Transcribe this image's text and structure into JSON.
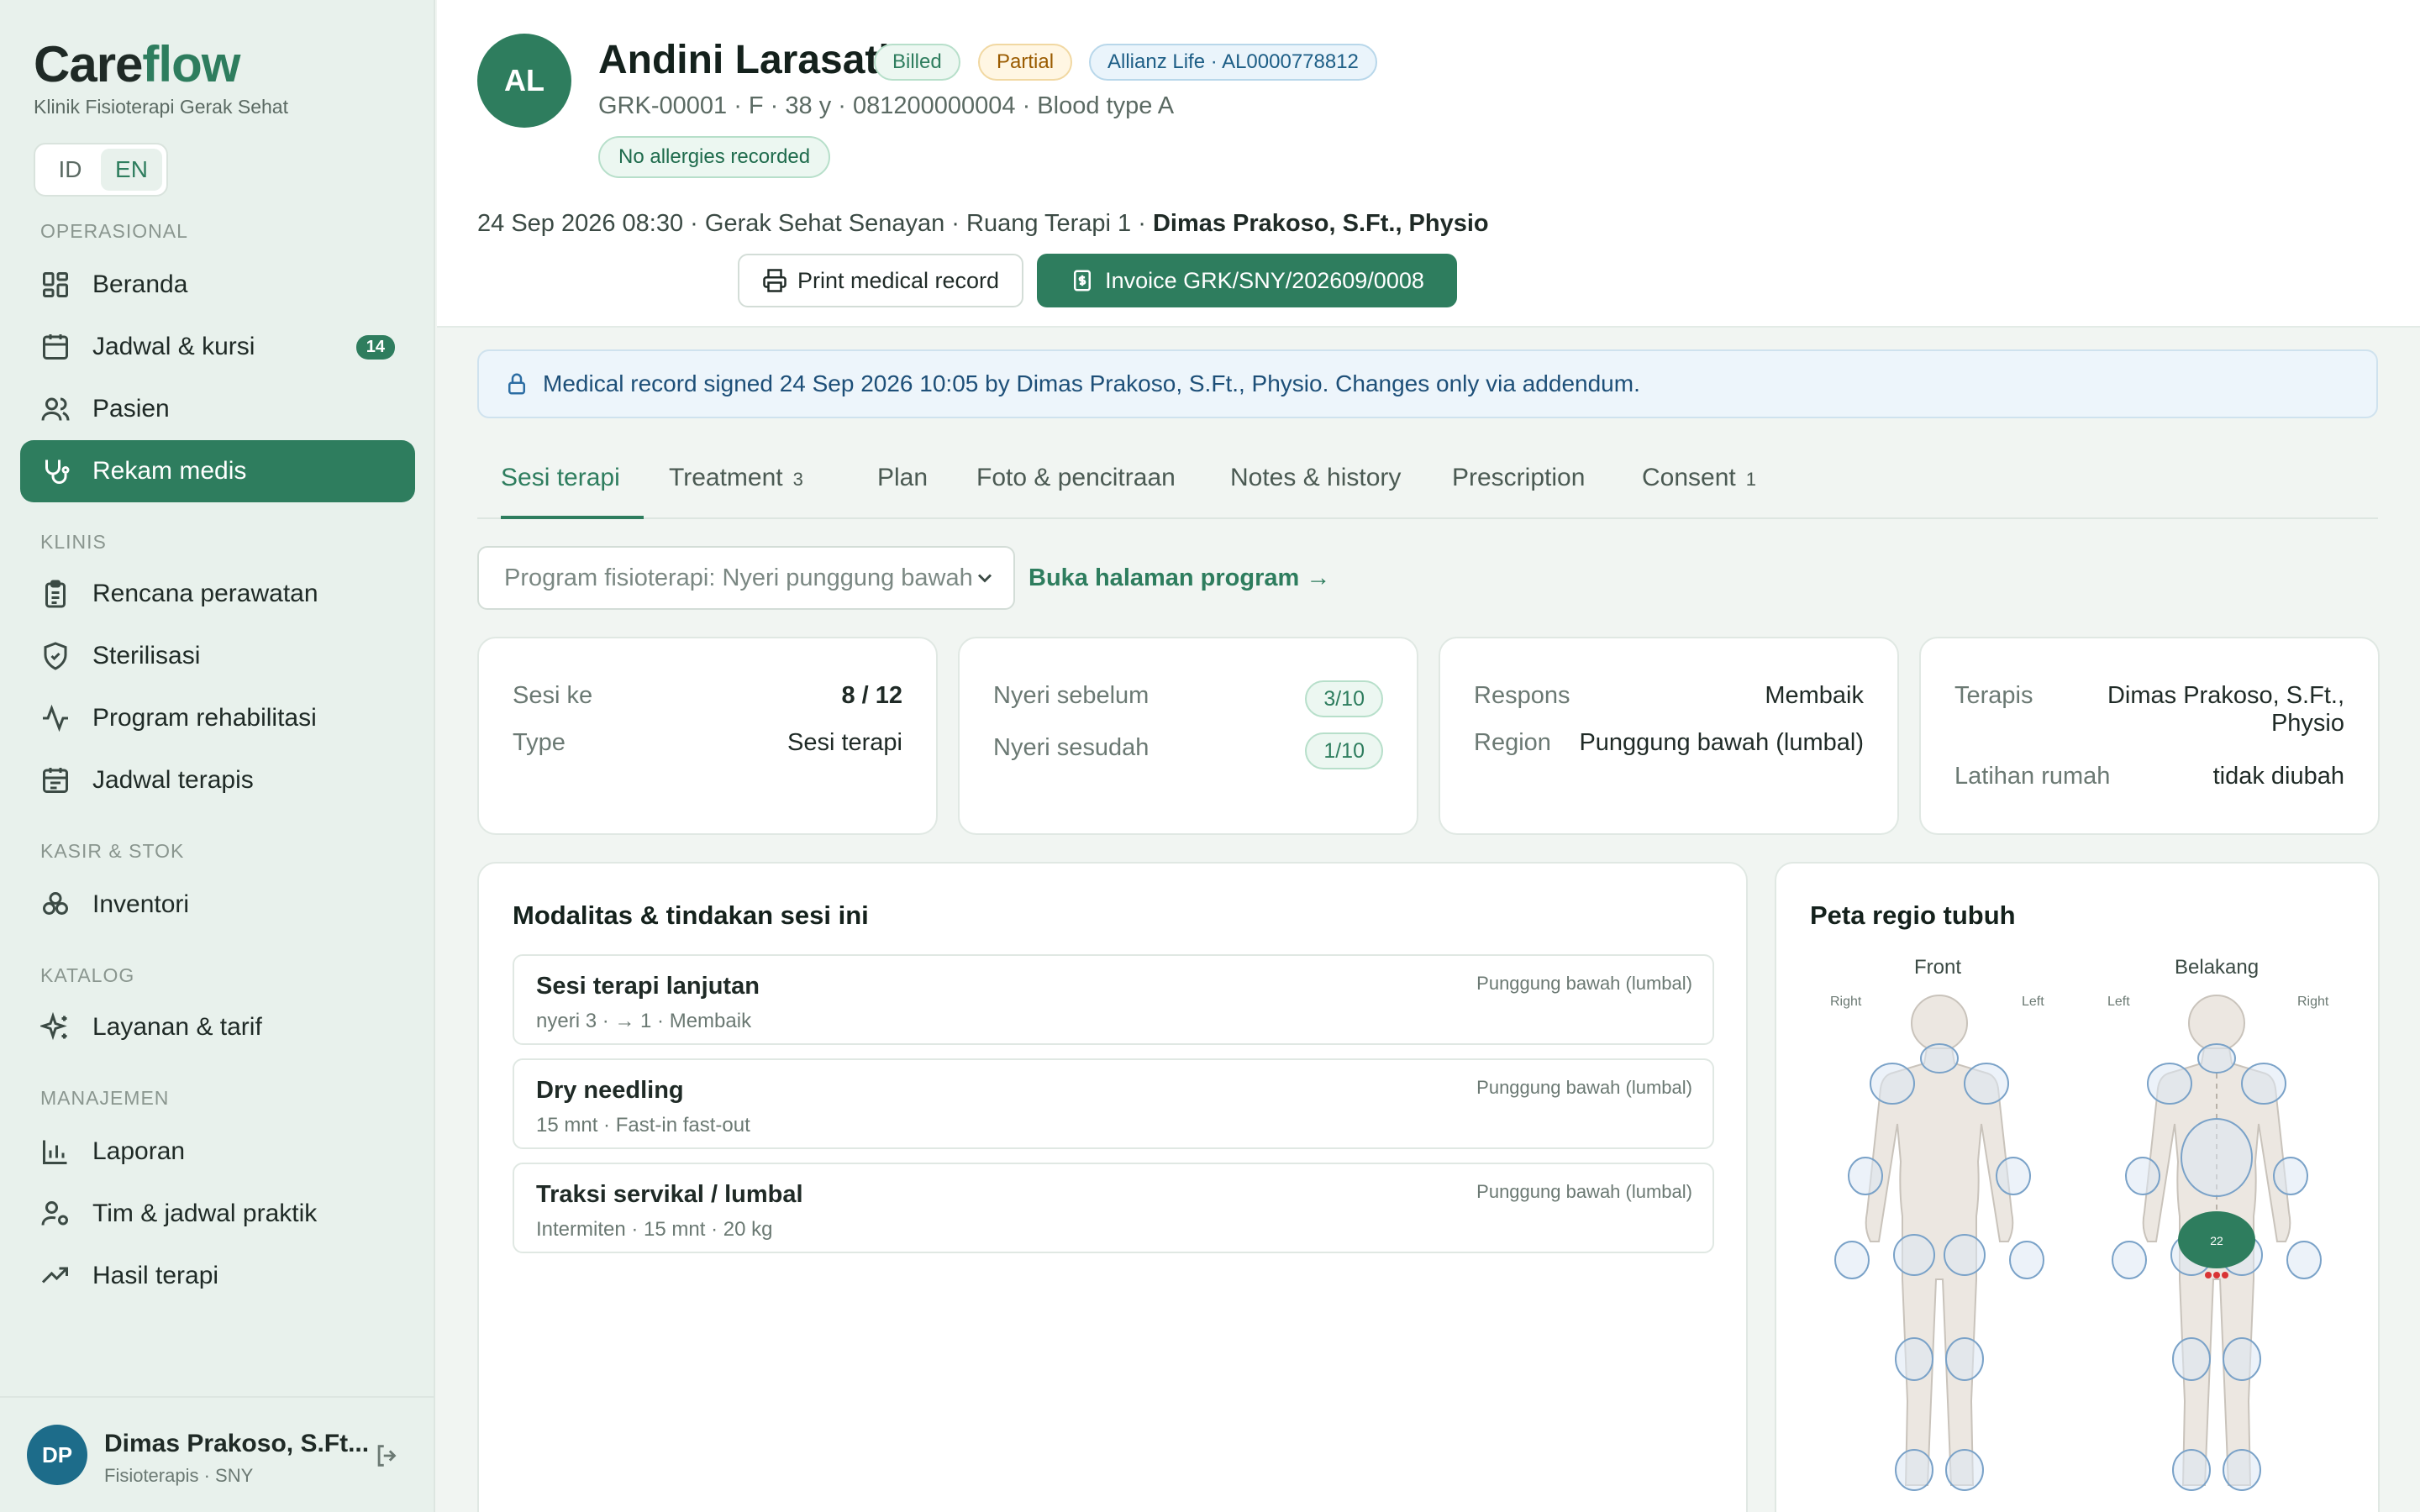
{
  "app": {
    "brand_a": "Care",
    "brand_b": "flow",
    "clinic": "Klinik Fisioterapi Gerak Sehat",
    "lang_id": "ID",
    "lang_en": "EN"
  },
  "sidebar": {
    "sec_ops": "OPERASIONAL",
    "sec_clin": "KLINIS",
    "sec_kasir": "KASIR & STOK",
    "sec_katalog": "KATALOG",
    "sec_man": "MANAJEMEN",
    "items": [
      {
        "label": "Beranda",
        "icon": "dashboard-icon"
      },
      {
        "label": "Jadwal & kursi",
        "icon": "calendar-icon",
        "badge": "14"
      },
      {
        "label": "Pasien",
        "icon": "users-icon"
      },
      {
        "label": "Rekam medis",
        "icon": "stethoscope-icon",
        "active": true
      },
      {
        "label": "Rencana perawatan",
        "icon": "clipboard-icon"
      },
      {
        "label": "Sterilisasi",
        "icon": "shield-icon"
      },
      {
        "label": "Program rehabilitasi",
        "icon": "activity-icon"
      },
      {
        "label": "Jadwal terapis",
        "icon": "calendar-icon"
      },
      {
        "label": "Inventori",
        "icon": "boxes-icon"
      },
      {
        "label": "Layanan & tarif",
        "icon": "sparkles-icon"
      },
      {
        "label": "Laporan",
        "icon": "bar-chart-icon"
      },
      {
        "label": "Tim & jadwal praktik",
        "icon": "user-cog-icon"
      },
      {
        "label": "Hasil terapi",
        "icon": "trending-up-icon"
      }
    ],
    "user": {
      "initials": "DP",
      "name": "Dimas Prakoso, S.Ft...",
      "role": "Fisioterapis · SNY"
    }
  },
  "patient": {
    "initials": "AL",
    "name": "Andini Larasati",
    "chip_billed": "Billed",
    "chip_partial": "Partial",
    "chip_insurance": "Allianz Life · AL0000778812",
    "meta": "GRK-00001 · F · 38 y · 081200000004 · Blood type A",
    "allergy": "No allergies recorded",
    "visit_prefix": "24 Sep 2026 08:30 · Gerak Sehat Senayan · Ruang Terapi 1 · ",
    "visit_doctor": "Dimas Prakoso, S.Ft., Physio",
    "btn_print": "Print medical record",
    "btn_invoice": "Invoice GRK/SNY/202609/0008"
  },
  "signed_notice": "Medical record signed 24 Sep 2026 10:05 by Dimas Prakoso, S.Ft., Physio. Changes only via addendum.",
  "tabs": [
    {
      "label": "Sesi terapi",
      "count": ""
    },
    {
      "label": "Treatment",
      "count": "3"
    },
    {
      "label": "Plan",
      "count": ""
    },
    {
      "label": "Foto & pencitraan",
      "count": ""
    },
    {
      "label": "Notes & history",
      "count": ""
    },
    {
      "label": "Prescription",
      "count": ""
    },
    {
      "label": "Consent",
      "count": "1"
    }
  ],
  "program_select": "Program fisioterapi: Nyeri punggung bawah",
  "program_link": "Buka halaman program →",
  "cards": {
    "c1": {
      "k1": "Sesi ke",
      "v1": "8 / 12",
      "k2": "Type",
      "v2": "Sesi terapi"
    },
    "c2": {
      "k1": "Nyeri sebelum",
      "v1": "3/10",
      "k2": "Nyeri sesudah",
      "v2": "1/10"
    },
    "c3": {
      "k1": "Respons",
      "v1": "Membaik",
      "k2": "Region",
      "v2": "Punggung bawah (lumbal)"
    },
    "c4": {
      "k1": "Terapis",
      "v1a": "Dimas Prakoso, S.Ft.,",
      "v1b": "Physio",
      "k2": "Latihan rumah",
      "v2": "tidak diubah"
    }
  },
  "modalities": {
    "title": "Modalitas & tindakan sesi ini",
    "items": [
      {
        "title": "Sesi terapi lanjutan",
        "sub": "nyeri 3 · → 1 · Membaik",
        "region": "Punggung bawah (lumbal)"
      },
      {
        "title": "Dry needling",
        "sub": "15 mnt · Fast-in fast-out",
        "region": "Punggung bawah (lumbal)"
      },
      {
        "title": "Traksi servikal / lumbal",
        "sub": "Intermiten · 15 mnt · 20 kg",
        "region": "Punggung bawah (lumbal)"
      }
    ]
  },
  "bodymap": {
    "title": "Peta regio tubuh",
    "front": "Front",
    "back": "Belakang",
    "front_right": "Right",
    "front_left": "Left",
    "back_left": "Left",
    "back_right": "Right",
    "marker": "22",
    "accent": "#2e7d5e"
  }
}
